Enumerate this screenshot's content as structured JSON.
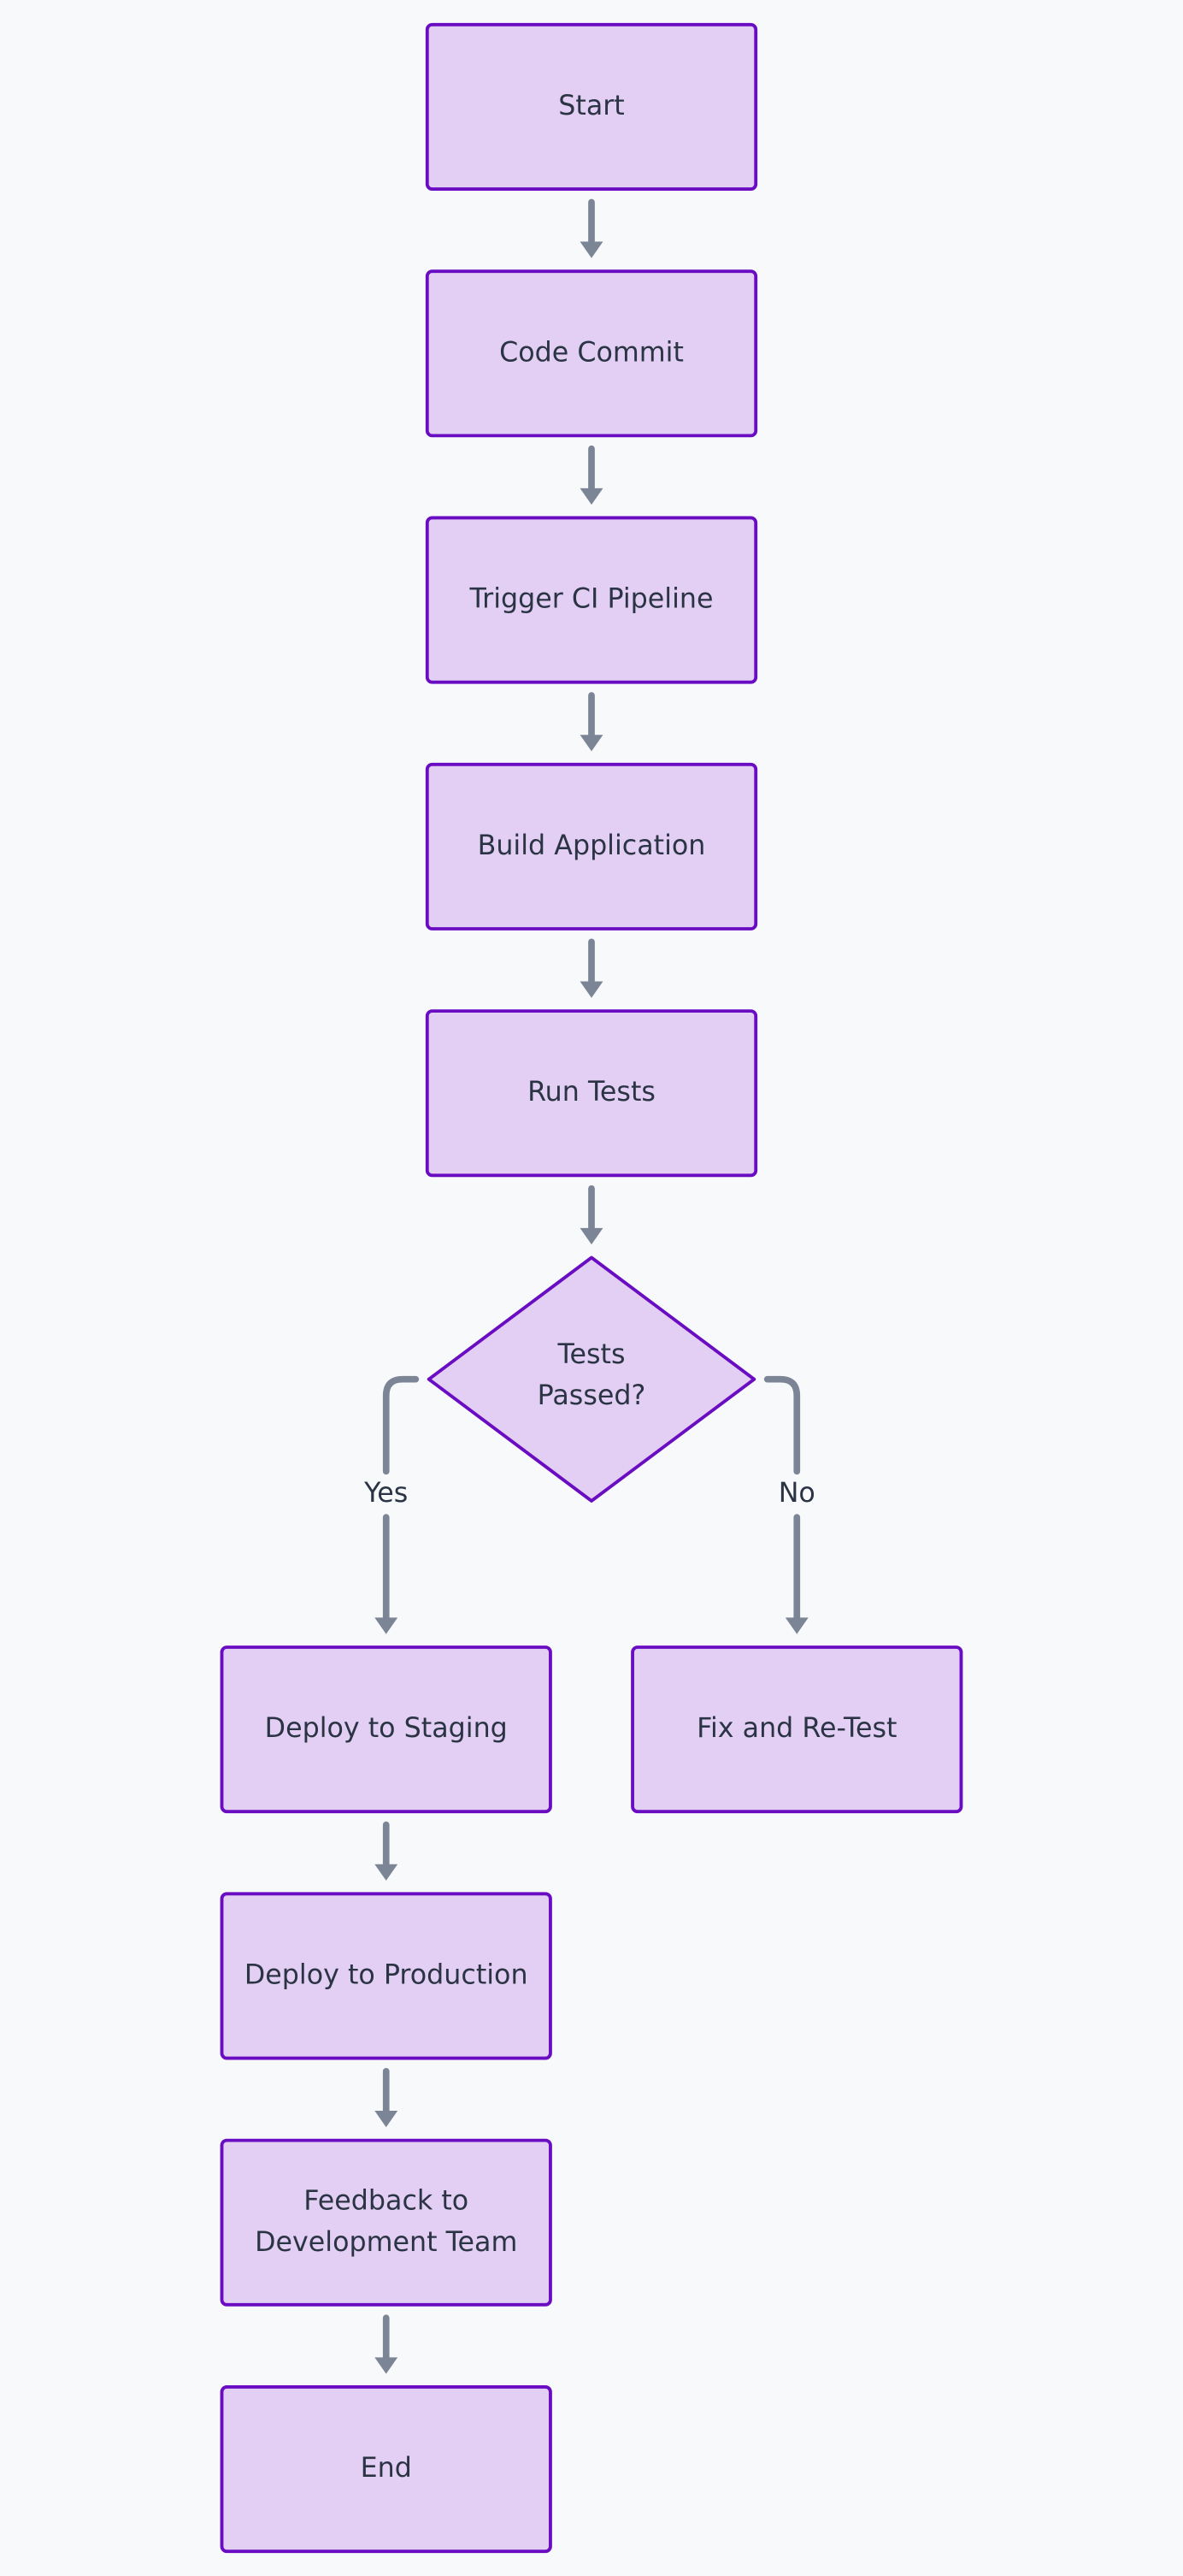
{
  "diagram": {
    "type": "flowchart",
    "direction": "top-to-bottom",
    "colors": {
      "node_fill": "#e3cff3",
      "node_stroke": "#6a0dc2",
      "edge": "#7b8595",
      "text": "#2b3445",
      "background": "#f7f9fb"
    },
    "nodes": [
      {
        "id": "start",
        "shape": "rect",
        "lines": [
          "Start"
        ]
      },
      {
        "id": "commit",
        "shape": "rect",
        "lines": [
          "Code Commit"
        ]
      },
      {
        "id": "ci",
        "shape": "rect",
        "lines": [
          "Trigger CI Pipeline"
        ]
      },
      {
        "id": "build",
        "shape": "rect",
        "lines": [
          "Build Application"
        ]
      },
      {
        "id": "tests",
        "shape": "rect",
        "lines": [
          "Run Tests"
        ]
      },
      {
        "id": "passed",
        "shape": "diamond",
        "lines": [
          "Tests",
          "Passed?"
        ]
      },
      {
        "id": "staging",
        "shape": "rect",
        "lines": [
          "Deploy to Staging"
        ]
      },
      {
        "id": "fix",
        "shape": "rect",
        "lines": [
          "Fix and Re-Test"
        ]
      },
      {
        "id": "prod",
        "shape": "rect",
        "lines": [
          "Deploy to Production"
        ]
      },
      {
        "id": "feedback",
        "shape": "rect",
        "lines": [
          "Feedback to",
          "Development Team"
        ]
      },
      {
        "id": "end",
        "shape": "rect",
        "lines": [
          "End"
        ]
      }
    ],
    "edges": [
      {
        "from": "start",
        "to": "commit",
        "label": ""
      },
      {
        "from": "commit",
        "to": "ci",
        "label": ""
      },
      {
        "from": "ci",
        "to": "build",
        "label": ""
      },
      {
        "from": "build",
        "to": "tests",
        "label": ""
      },
      {
        "from": "tests",
        "to": "passed",
        "label": ""
      },
      {
        "from": "passed",
        "to": "staging",
        "label": "Yes"
      },
      {
        "from": "passed",
        "to": "fix",
        "label": "No"
      },
      {
        "from": "staging",
        "to": "prod",
        "label": ""
      },
      {
        "from": "prod",
        "to": "feedback",
        "label": ""
      },
      {
        "from": "feedback",
        "to": "end",
        "label": ""
      }
    ]
  }
}
